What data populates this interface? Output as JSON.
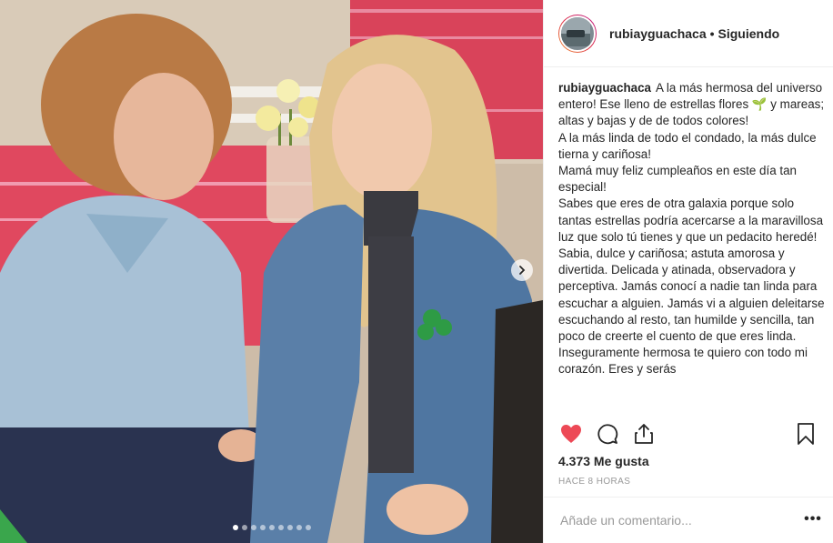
{
  "post": {
    "username": "rubiayguachaca",
    "separator": "•",
    "follow_status": "Siguiendo"
  },
  "caption": {
    "username": "rubiayguachaca",
    "lines": [
      "A la más hermosa del universo entero! Ese lleno de estrellas flores 🌱 y mareas; altas y bajas y de de todos colores!",
      "A la más linda de todo el condado, la más dulce tierna y cariñosa!",
      "Mamá muy feliz cumpleaños en este día tan especial!",
      "Sabes que eres de otra galaxia porque solo tantas estrellas podría acercarse a la maravillosa luz que solo tú tienes y que un pedacito heredé!",
      "Sabia, dulce y cariñosa; astuta amorosa y divertida. Delicada y atinada, observadora y perceptiva. Jamás conocí a nadie tan linda para escuchar a alguien. Jamás vi a alguien deleitarse escuchando al resto, tan humilde y sencilla, tan poco de creerte el cuento de que eres linda. Inseguramente hermosa te quiero con todo mi corazón. Eres y serás"
    ]
  },
  "actions": {
    "like_icon": "heart-filled-icon",
    "comment_icon": "comment-bubble-icon",
    "share_icon": "share-upload-icon",
    "save_icon": "bookmark-icon"
  },
  "likes_text": "4.373 Me gusta",
  "timestamp": "HACE 8 HORAS",
  "comment_input": {
    "placeholder": "Añade un comentario...",
    "value": ""
  },
  "more_label": "•••",
  "carousel": {
    "total": 9,
    "active_index": 0
  },
  "colors": {
    "like_red": "#ed4956",
    "muted_text": "#999999",
    "border": "#efefef"
  }
}
